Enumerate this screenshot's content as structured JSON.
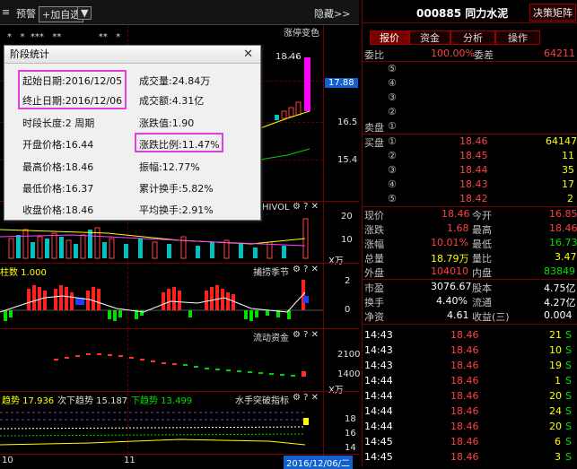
{
  "toolbar": {
    "alert": "预警",
    "add_favorite": "+加自选",
    "dropdown": "▼",
    "hide": "隐藏>>"
  },
  "chart": {
    "limit_up_color_label": "涨停变色",
    "price_label_high": "18.46",
    "price_marker": "17.88",
    "y_ticks": [
      "16.5",
      "15.4"
    ],
    "volume_header": "HIVOL",
    "volume_ticks": [
      "20",
      "10"
    ],
    "volume_unit": "X万",
    "indicator1_header_left": "柱数 1.000",
    "indicator1_header_right": "捕捞季节",
    "indicator1_ticks": [
      "2",
      "0"
    ],
    "indicator2_header": "流动资金",
    "indicator2_ticks": [
      "2100",
      "1400"
    ],
    "indicator2_unit": "X万",
    "indicator3_trend": "趋势 17.936",
    "indicator3_next": "次下趋势 15.187",
    "indicator3_down": "下趋势 13.499",
    "indicator3_name": "水手突破指标",
    "indicator3_ticks": [
      "18",
      "16",
      "14"
    ],
    "x_axis": [
      "10",
      "11"
    ],
    "date_cursor": "2016/12/06/二",
    "stars": "*   *  ***   **             **   *"
  },
  "dialog": {
    "title": "阶段统计",
    "close": "✕",
    "start_date": "起始日期:2016/12/05",
    "end_date": "终止日期:2016/12/06",
    "period": "时段长度:2 周期",
    "open": "开盘价格:16.44",
    "high": "最高价格:18.46",
    "low": "最低价格:16.37",
    "close_price": "收盘价格:18.46",
    "volume": "成交量:24.84万",
    "amount": "成交额:4.31亿",
    "change": "涨跌值:1.90",
    "change_pct": "涨跌比例:11.47%",
    "amplitude": "振幅:12.77%",
    "turnover_total": "累计换手:5.82%",
    "turnover_avg": "平均换手:2.91%"
  },
  "quote": {
    "code_name": "000885 同力水泥",
    "matrix_btn": "决策矩阵",
    "tabs": [
      "报价",
      "资金",
      "分析",
      "操作"
    ],
    "wei_bi_label": "委比",
    "wei_bi": "100.00%",
    "wei_cha_label": "委差",
    "wei_cha": "64211",
    "sell_label": "卖盘",
    "sell_levels": [
      "⑤",
      "④",
      "③",
      "②",
      "①"
    ],
    "buy_label": "买盘",
    "buy_levels": [
      {
        "lvl": "①",
        "price": "18.46",
        "vol": "64147"
      },
      {
        "lvl": "②",
        "price": "18.45",
        "vol": "11"
      },
      {
        "lvl": "③",
        "price": "18.44",
        "vol": "35"
      },
      {
        "lvl": "④",
        "price": "18.43",
        "vol": "17"
      },
      {
        "lvl": "⑤",
        "price": "18.42",
        "vol": "2"
      }
    ],
    "stats": [
      {
        "l1": "现价",
        "v1": "18.46",
        "l2": "今开",
        "v2": "16.85",
        "c1": "red",
        "c2": "red"
      },
      {
        "l1": "涨跌",
        "v1": "1.68",
        "l2": "最高",
        "v2": "18.46",
        "c1": "red",
        "c2": "red"
      },
      {
        "l1": "涨幅",
        "v1": "10.01%",
        "l2": "最低",
        "v2": "16.73",
        "c1": "red",
        "c2": "green"
      },
      {
        "l1": "总量",
        "v1": "18.79万",
        "l2": "量比",
        "v2": "3.47",
        "c1": "yellow",
        "c2": "yellow"
      },
      {
        "l1": "外盘",
        "v1": "104010",
        "l2": "内盘",
        "v2": "83849",
        "c1": "red",
        "c2": "green"
      }
    ],
    "stats2": [
      {
        "l1": "市盈",
        "v1": "3076.67",
        "l2": "股本",
        "v2": "4.75亿"
      },
      {
        "l1": "换手",
        "v1": "4.40%",
        "l2": "流通",
        "v2": "4.27亿"
      },
      {
        "l1": "净资",
        "v1": "4.61",
        "l2": "收益(三)",
        "v2": "0.004"
      }
    ],
    "ticks": [
      {
        "t": "14:43",
        "p": "18.46",
        "v": "21",
        "d": "S"
      },
      {
        "t": "14:43",
        "p": "18.46",
        "v": "10",
        "d": "S"
      },
      {
        "t": "14:43",
        "p": "18.46",
        "v": "19",
        "d": "S"
      },
      {
        "t": "14:44",
        "p": "18.46",
        "v": "1",
        "d": "S"
      },
      {
        "t": "14:44",
        "p": "18.46",
        "v": "20",
        "d": "S"
      },
      {
        "t": "14:44",
        "p": "18.46",
        "v": "24",
        "d": "S"
      },
      {
        "t": "14:44",
        "p": "18.46",
        "v": "20",
        "d": "S"
      },
      {
        "t": "14:45",
        "p": "18.46",
        "v": "6",
        "d": "S"
      },
      {
        "t": "14:45",
        "p": "18.46",
        "v": "3",
        "d": "S"
      }
    ]
  }
}
